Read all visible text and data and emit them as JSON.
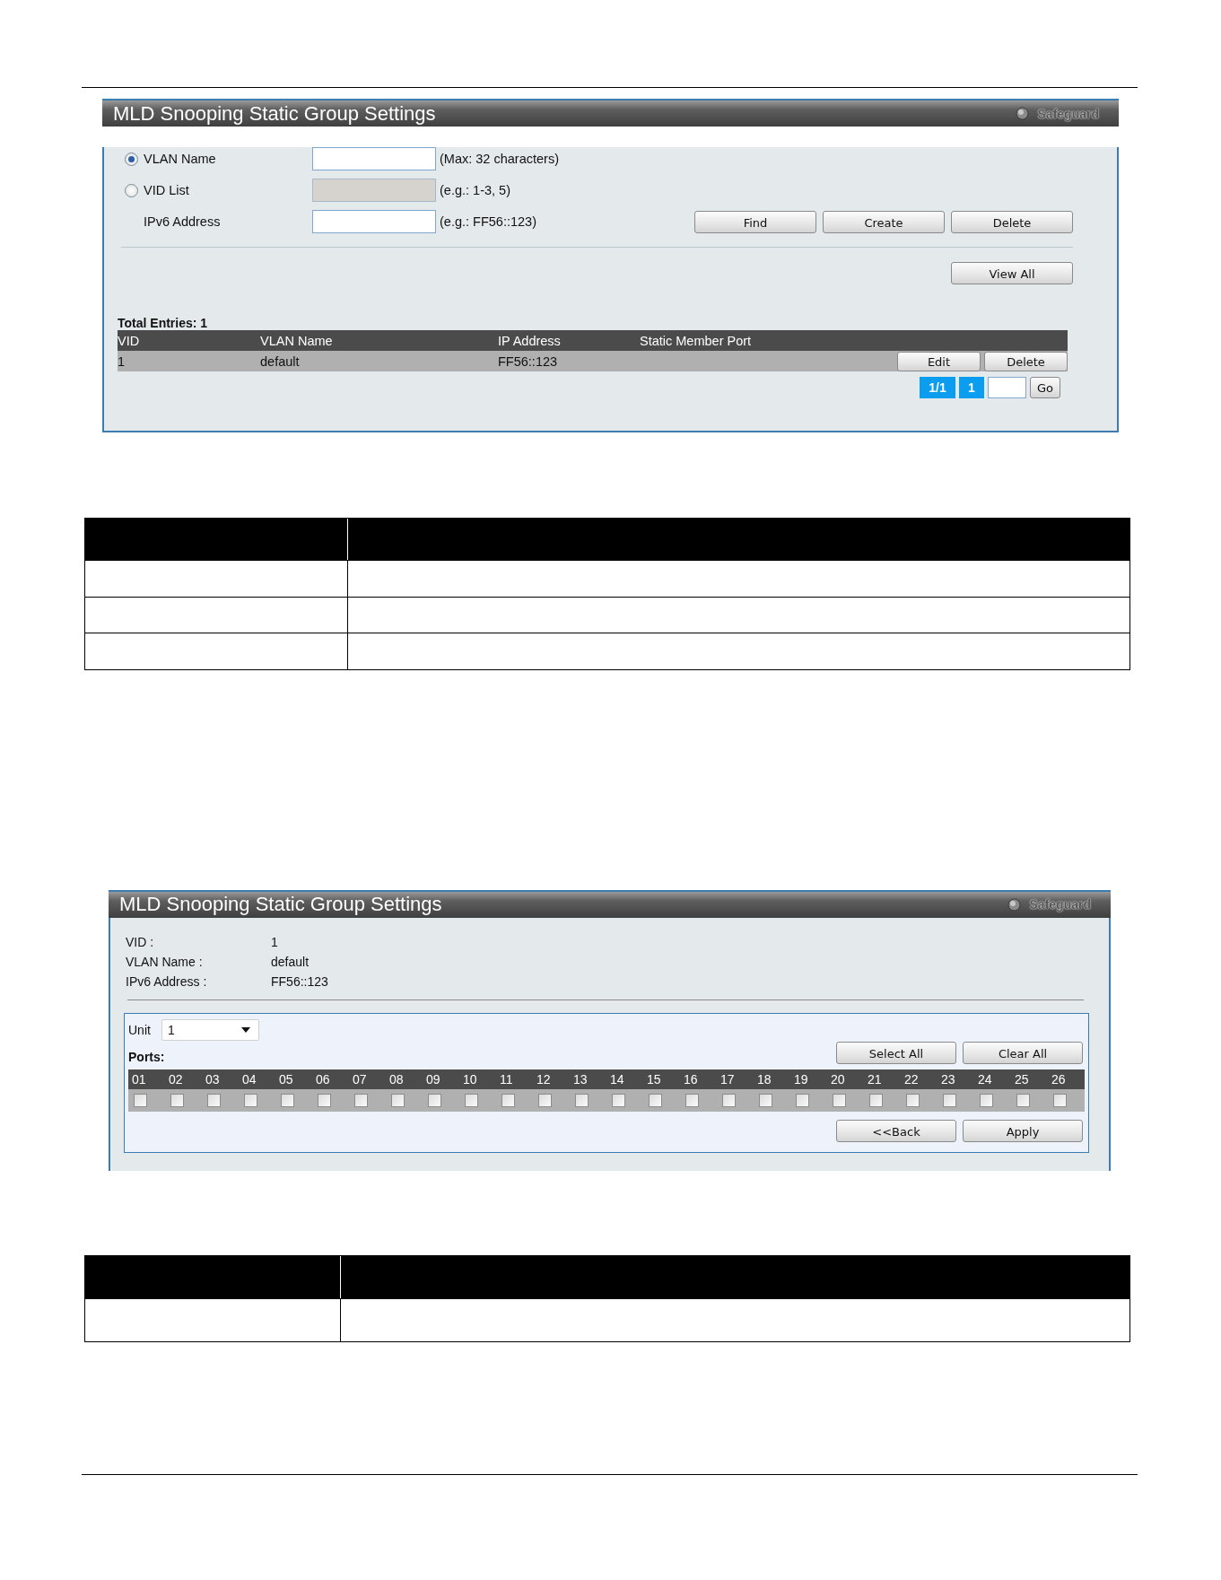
{
  "search_panel": {
    "title": "MLD Snooping Static Group Settings",
    "safeguard": "Safeguard",
    "fields": [
      {
        "kind": "radio",
        "label": "VLAN Name",
        "selected": true,
        "disabled": false,
        "hint": "(Max: 32 characters)"
      },
      {
        "kind": "radio",
        "label": "VID List",
        "selected": false,
        "disabled": true,
        "hint": "(e.g.: 1-3, 5)"
      },
      {
        "kind": "plain",
        "label": "IPv6 Address",
        "disabled": false,
        "hint": "(e.g.: FF56::123)"
      }
    ],
    "action_buttons": [
      "Find",
      "Create",
      "Delete"
    ],
    "view_all": "View All",
    "total_entries": "Total Entries: 1",
    "table": {
      "columns": [
        "VID",
        "VLAN Name",
        "IP Address",
        "Static Member Port"
      ],
      "rows": [
        {
          "cells": [
            "1",
            "default",
            "FF56::123"
          ],
          "buttons": [
            "Edit",
            "Delete"
          ]
        }
      ]
    },
    "pagination": {
      "pages": "1/1",
      "page": "1",
      "go": "Go"
    }
  },
  "edit_panel": {
    "title": "MLD Snooping Static Group Settings",
    "safeguard": "Safeguard",
    "info": [
      {
        "label": "VID :",
        "value": "1"
      },
      {
        "label": "VLAN Name :",
        "value": "default"
      },
      {
        "label": "IPv6 Address :",
        "value": "FF56::123"
      }
    ],
    "unit_label": "Unit",
    "unit_value": "1",
    "ports_label": "Ports:",
    "select_buttons": [
      "Select All",
      "Clear All"
    ],
    "ports": [
      {
        "label": "01",
        "checked": false
      },
      {
        "label": "02",
        "checked": false
      },
      {
        "label": "03",
        "checked": false
      },
      {
        "label": "04",
        "checked": false
      },
      {
        "label": "05",
        "checked": false
      },
      {
        "label": "06",
        "checked": false
      },
      {
        "label": "07",
        "checked": false
      },
      {
        "label": "08",
        "checked": false
      },
      {
        "label": "09",
        "checked": false
      },
      {
        "label": "10",
        "checked": false
      },
      {
        "label": "11",
        "checked": false
      },
      {
        "label": "12",
        "checked": false
      },
      {
        "label": "13",
        "checked": false
      },
      {
        "label": "14",
        "checked": false
      },
      {
        "label": "15",
        "checked": false
      },
      {
        "label": "16",
        "checked": false
      },
      {
        "label": "17",
        "checked": false
      },
      {
        "label": "18",
        "checked": false
      },
      {
        "label": "19",
        "checked": false
      },
      {
        "label": "20",
        "checked": false
      },
      {
        "label": "21",
        "checked": false
      },
      {
        "label": "22",
        "checked": false
      },
      {
        "label": "23",
        "checked": false
      },
      {
        "label": "24",
        "checked": false
      },
      {
        "label": "25",
        "checked": false
      },
      {
        "label": "26",
        "checked": false
      }
    ],
    "bottom_buttons": [
      "<<Back",
      "Apply"
    ]
  }
}
